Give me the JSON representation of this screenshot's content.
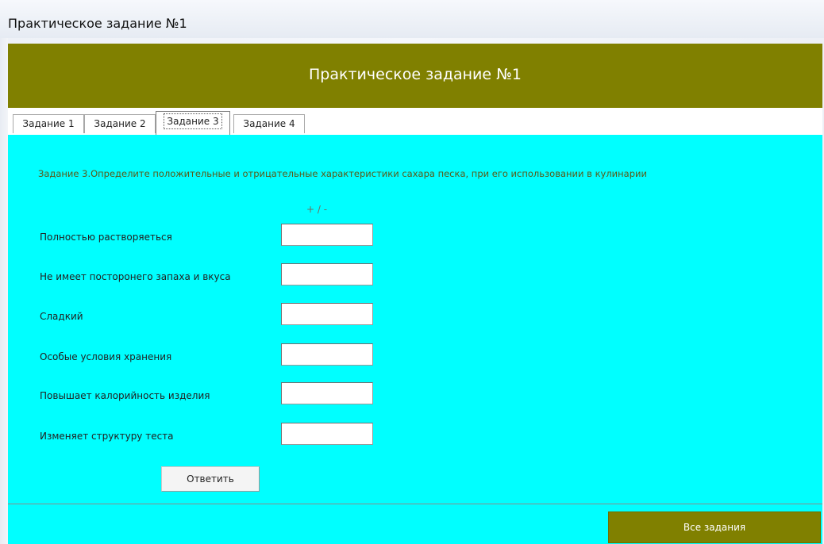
{
  "window": {
    "title": "Практическое задание №1"
  },
  "header": {
    "title": "Практическое задание №1",
    "bg_color": "#808000"
  },
  "tabs": [
    {
      "label": "Задание 1",
      "active": false
    },
    {
      "label": "Задание 2",
      "active": false
    },
    {
      "label": "Задание 3",
      "active": true
    },
    {
      "label": "Задание 4",
      "active": false
    }
  ],
  "content": {
    "bg_color": "#00ffff",
    "question": "Задание 3.Определите положительные и отрицательные характеристики сахара песка, при его использовании в кулинарии",
    "column_hint": "+ / -",
    "rows": [
      {
        "label": "Полностью растворяеться",
        "value": ""
      },
      {
        "label": "Не имеет посторонего запаха и вкуса",
        "value": ""
      },
      {
        "label": "Сладкий",
        "value": ""
      },
      {
        "label": "Особые условия хранения",
        "value": ""
      },
      {
        "label": "Повышает калорийность изделия",
        "value": ""
      },
      {
        "label": "Изменяет структуру теста",
        "value": ""
      }
    ],
    "answer_button": "Ответить"
  },
  "footer": {
    "all_tasks_button": "Все задания"
  }
}
